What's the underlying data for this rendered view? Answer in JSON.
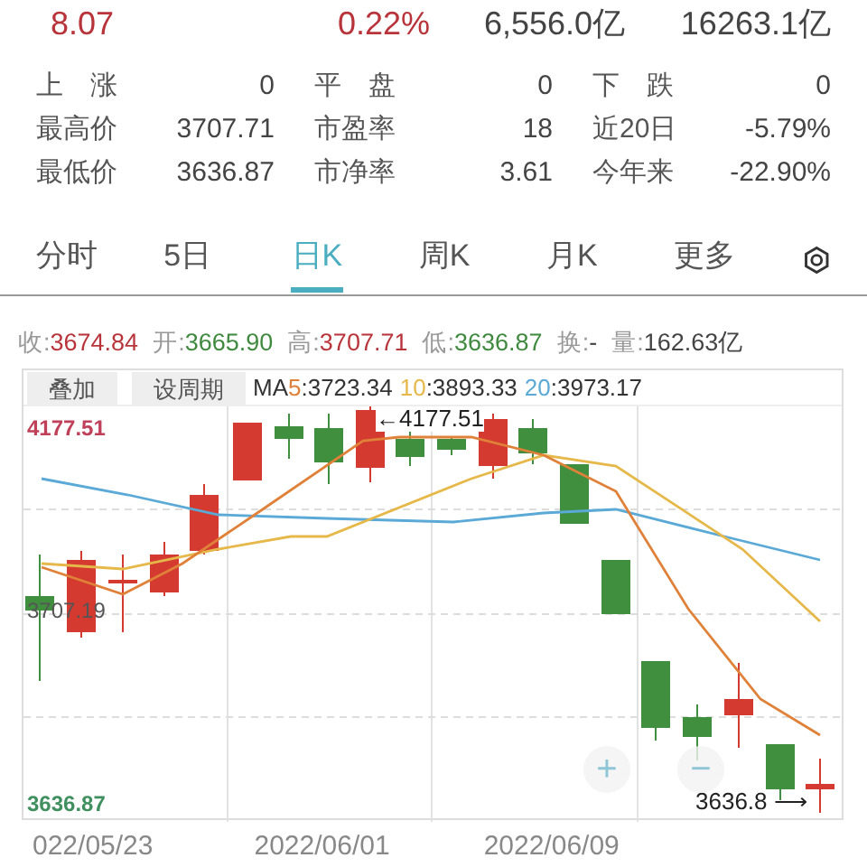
{
  "quote": {
    "change": "8.07",
    "change_pct": "0.22%",
    "turnover": "6,556.0亿",
    "market_value": "16263.1亿"
  },
  "stats": [
    [
      {
        "label": "上　涨",
        "value": "0"
      },
      {
        "label": "平　盘",
        "value": "0"
      },
      {
        "label": "下　跌",
        "value": "0"
      }
    ],
    [
      {
        "label": "最高价",
        "value": "3707.71"
      },
      {
        "label": "市盈率",
        "value": "18"
      },
      {
        "label": "近20日",
        "value": "-5.79%"
      }
    ],
    [
      {
        "label": "最低价",
        "value": "3636.87"
      },
      {
        "label": "市净率",
        "value": "3.61"
      },
      {
        "label": "今年来",
        "value": "-22.90%"
      }
    ]
  ],
  "tabs": [
    {
      "label": "分时",
      "selected": false
    },
    {
      "label": "5日",
      "selected": false
    },
    {
      "label": "日K",
      "selected": true
    },
    {
      "label": "周K",
      "selected": false
    },
    {
      "label": "月K",
      "selected": false
    },
    {
      "label": "更多",
      "selected": false
    }
  ],
  "ohlc": [
    {
      "label": "收:",
      "value": "3674.84",
      "color": "#b8343a"
    },
    {
      "label": "开:",
      "value": "3665.90",
      "color": "#3f8a3f"
    },
    {
      "label": "高:",
      "value": "3707.71",
      "color": "#b8343a"
    },
    {
      "label": "低:",
      "value": "3636.87",
      "color": "#3f8a3f"
    },
    {
      "label": "换:",
      "value": "-",
      "color": "#444444"
    },
    {
      "label": "量:",
      "value": "162.63亿",
      "color": "#444444"
    }
  ],
  "toolbar": [
    "叠加",
    "设周期"
  ],
  "ma": {
    "label": "MA",
    "items": [
      {
        "period": "5",
        "value": ":3723.34",
        "color": "#e0813a"
      },
      {
        "period": "10",
        "value": ":3893.33",
        "color": "#e6b84a"
      },
      {
        "period": "20",
        "value": ":3973.17",
        "color": "#5aa9d6"
      }
    ]
  },
  "chart": {
    "high_label": "4177.51",
    "mid_label": "3707.19",
    "low_label": "3636.87",
    "max_marker": "←4177.51",
    "min_marker": "3636.8 ⟶",
    "zoom_buttons": [
      "+",
      "−"
    ],
    "dates": [
      "022/05/23",
      "2022/06/01",
      "2022/06/09"
    ]
  }
}
